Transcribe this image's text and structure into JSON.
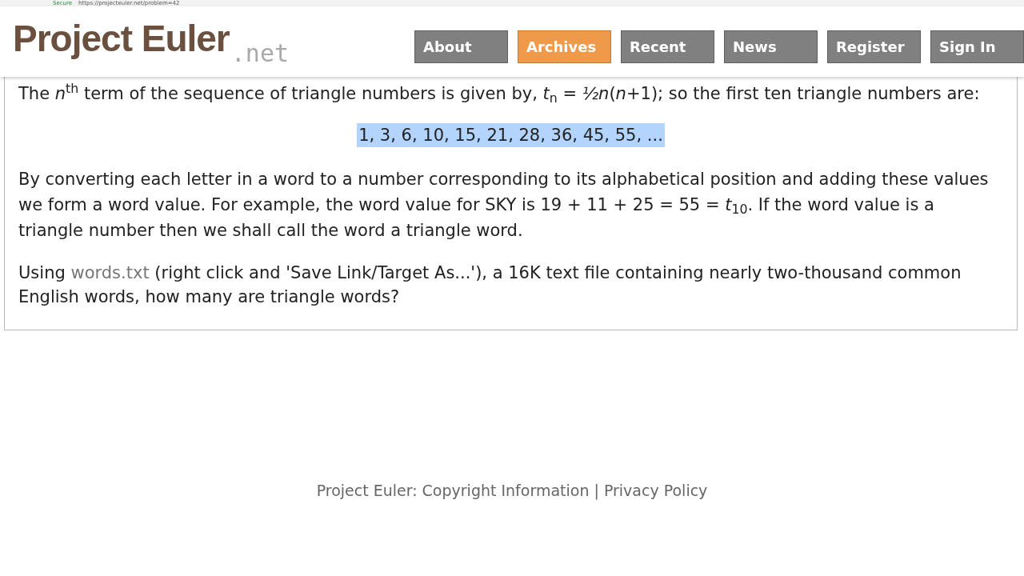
{
  "browser": {
    "security": "Secure",
    "url": "https://projecteuler.net/problem=42"
  },
  "logo": {
    "name": "Project Euler",
    "suffix": ".net"
  },
  "nav": [
    {
      "label": "About",
      "selected": false
    },
    {
      "label": "Archives",
      "selected": true
    },
    {
      "label": "Recent",
      "selected": false
    },
    {
      "label": "News",
      "selected": false
    },
    {
      "label": "Register",
      "selected": false
    },
    {
      "label": "Sign In",
      "selected": false
    }
  ],
  "problem": {
    "intro": "The *n*$^{th}$ term of the sequence of triangle numbers is given by, *t*$_{n}$ = *½n*(*n*+1); so the first ten triangle numbers are:",
    "sequence": "1, 3, 6, 10, 15, 21, 28, 36, 45, 55, ...",
    "sequence_selected": true,
    "explanation": "By converting each letter in a word to a number corresponding to its alphabetical position and adding these values we form a word value. For example, the word value for SKY is 19 + 11 + 25 = 55 = *t*$_{10}$. If the word value is a triangle number then we shall call the word a triangle word.",
    "question": {
      "before": "Using",
      "link": "words.txt",
      "after": "(right click and 'Save Link/Target As...'), a 16K text file containing nearly two-thousand common English words, how many are triangle words?"
    }
  },
  "footer": {
    "site": "Project Euler:",
    "links": [
      "Copyright Information",
      "Privacy Policy"
    ],
    "separator": "|"
  }
}
